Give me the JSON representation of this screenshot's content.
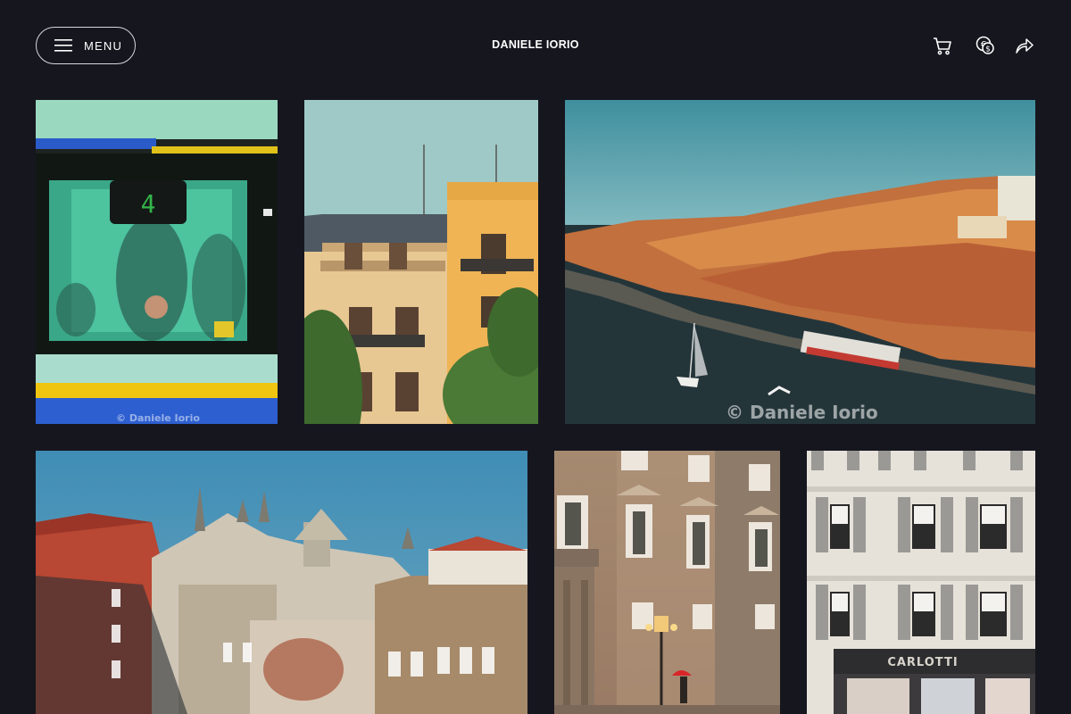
{
  "header": {
    "menu_label": "MENU",
    "site_title": "DANIELE IORIO",
    "icons": [
      "hamburger-icon",
      "cart-icon",
      "currency-icon",
      "share-icon"
    ]
  },
  "gallery": {
    "watermark": "© Daniele Iorio",
    "items": [
      {
        "alt": "Tram window with passengers, route 4"
      },
      {
        "alt": "Ornate yellow building facade"
      },
      {
        "alt": "Porto riverside panorama"
      },
      {
        "alt": "Church spires and old houses at sunset"
      },
      {
        "alt": "Stone palace facade with street lamp and red umbrella"
      },
      {
        "alt": "White building with grey shutters and Carlotti shop"
      }
    ],
    "shop_sign": "CARLOTTI"
  },
  "colors": {
    "background": "#16161f",
    "text": "#ffffff"
  }
}
